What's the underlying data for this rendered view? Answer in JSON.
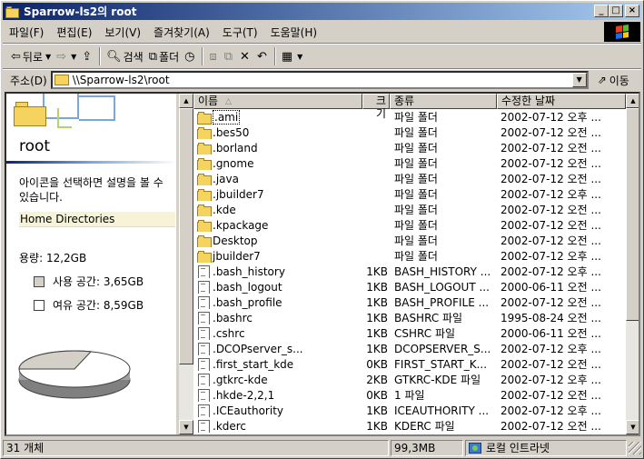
{
  "window": {
    "title": "Sparrow-ls2의 root"
  },
  "menu": [
    "파일(F)",
    "편집(E)",
    "보기(V)",
    "즐겨찾기(A)",
    "도구(T)",
    "도움말(H)"
  ],
  "toolbar": {
    "back_label": "뒤로",
    "search_label": "검색",
    "folders_label": "폴더"
  },
  "address": {
    "label": "주소(D)",
    "value": "\\\\Sparrow-ls2\\root",
    "go_label": "이동"
  },
  "left_pane": {
    "title": "root",
    "description": "아이콘을 선택하면 설명을 볼 수 있습니다.",
    "link": "Home Directories",
    "capacity": "용량: 12,2GB",
    "used": "사용 공간: 3,65GB",
    "free": "여유 공간: 8,59GB",
    "used_color": "#d4d0c8",
    "free_color": "#ffffff",
    "used_fraction": 0.298
  },
  "columns": {
    "name": "이름",
    "size": "크기",
    "type": "종류",
    "modified": "수정한 날짜"
  },
  "files": [
    {
      "icon": "folder",
      "name": ".ami",
      "size": "",
      "type": "파일 폴더",
      "modified": "2002-07-12 오후 ..."
    },
    {
      "icon": "folder",
      "name": ".bes50",
      "size": "",
      "type": "파일 폴더",
      "modified": "2002-07-12 오전 ..."
    },
    {
      "icon": "folder",
      "name": ".borland",
      "size": "",
      "type": "파일 폴더",
      "modified": "2002-07-12 오전 ..."
    },
    {
      "icon": "folder",
      "name": ".gnome",
      "size": "",
      "type": "파일 폴더",
      "modified": "2002-07-12 오전 ..."
    },
    {
      "icon": "folder",
      "name": ".java",
      "size": "",
      "type": "파일 폴더",
      "modified": "2002-07-12 오전 ..."
    },
    {
      "icon": "folder",
      "name": ".jbuilder7",
      "size": "",
      "type": "파일 폴더",
      "modified": "2002-07-12 오후 ..."
    },
    {
      "icon": "folder",
      "name": ".kde",
      "size": "",
      "type": "파일 폴더",
      "modified": "2002-07-12 오전 ..."
    },
    {
      "icon": "folder",
      "name": ".kpackage",
      "size": "",
      "type": "파일 폴더",
      "modified": "2002-07-12 오전 ..."
    },
    {
      "icon": "folder",
      "name": "Desktop",
      "size": "",
      "type": "파일 폴더",
      "modified": "2002-07-12 오전 ..."
    },
    {
      "icon": "folder",
      "name": "jbuilder7",
      "size": "",
      "type": "파일 폴더",
      "modified": "2002-07-12 오후 ..."
    },
    {
      "icon": "file",
      "name": ".bash_history",
      "size": "1KB",
      "type": "BASH_HISTORY ...",
      "modified": "2002-07-12 오후 ..."
    },
    {
      "icon": "file",
      "name": ".bash_logout",
      "size": "1KB",
      "type": "BASH_LOGOUT ...",
      "modified": "2000-06-11 오전 ..."
    },
    {
      "icon": "file",
      "name": ".bash_profile",
      "size": "1KB",
      "type": "BASH_PROFILE ...",
      "modified": "2002-07-12 오전 ..."
    },
    {
      "icon": "file",
      "name": ".bashrc",
      "size": "1KB",
      "type": "BASHRC 파일",
      "modified": "1995-08-24 오전 ..."
    },
    {
      "icon": "file",
      "name": ".cshrc",
      "size": "1KB",
      "type": "CSHRC 파일",
      "modified": "2000-06-11 오전 ..."
    },
    {
      "icon": "file",
      "name": ".DCOPserver_s...",
      "size": "1KB",
      "type": "DCOPSERVER_S...",
      "modified": "2002-07-12 오후 ..."
    },
    {
      "icon": "file",
      "name": ".first_start_kde",
      "size": "0KB",
      "type": "FIRST_START_K...",
      "modified": "2002-07-12 오전 ..."
    },
    {
      "icon": "file",
      "name": ".gtkrc-kde",
      "size": "2KB",
      "type": "GTKRC-KDE 파일",
      "modified": "2002-07-12 오후 ..."
    },
    {
      "icon": "file",
      "name": ".hkde-2,2,1",
      "size": "0KB",
      "type": "1 파일",
      "modified": "2002-07-12 오전 ..."
    },
    {
      "icon": "file",
      "name": ".ICEauthority",
      "size": "1KB",
      "type": "ICEAUTHORITY ...",
      "modified": "2002-07-12 오후 ..."
    },
    {
      "icon": "file",
      "name": ".kderc",
      "size": "1KB",
      "type": "KDERC 파일",
      "modified": "2002-07-12 오전 ..."
    }
  ],
  "status": {
    "count": "31 개체",
    "size": "99,3MB",
    "zone": "로컬 인트라넷"
  }
}
